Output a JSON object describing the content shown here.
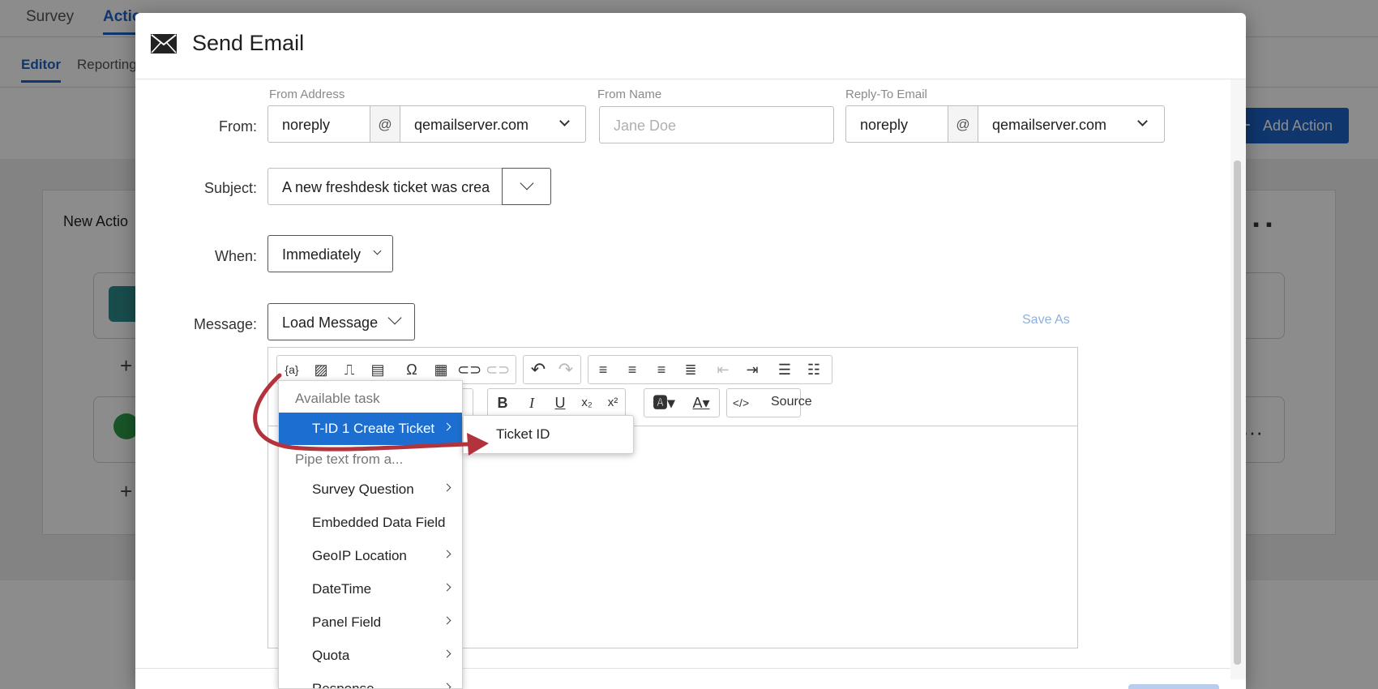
{
  "background": {
    "top_tabs": [
      "Survey",
      "Actio"
    ],
    "sub_tabs": [
      "Editor",
      "Reporting"
    ],
    "card_title": "New Actio",
    "add_action_label": "Add Action"
  },
  "modal": {
    "title": "Send Email",
    "from": {
      "label": "From:",
      "address_caption": "From Address",
      "address_user": "noreply",
      "at": "@",
      "address_domain": "qemailserver.com",
      "name_caption": "From Name",
      "name_placeholder": "Jane Doe",
      "reply_caption": "Reply-To Email",
      "reply_user": "noreply",
      "reply_domain": "qemailserver.com"
    },
    "subject": {
      "label": "Subject:",
      "value": "A new freshdesk ticket was crea"
    },
    "when": {
      "label": "When:",
      "value": "Immediately"
    },
    "message": {
      "label": "Message:",
      "load_label": "Load Message",
      "save_as": "Save As"
    },
    "toolbar": {
      "source_label": "Source"
    }
  },
  "piped_menu": {
    "available_task_header": "Available task",
    "selected_item": "T-ID 1 Create Ticket",
    "pipe_header": "Pipe text from a...",
    "items": [
      {
        "label": "Survey Question",
        "submenu": true
      },
      {
        "label": "Embedded Data Field",
        "submenu": false
      },
      {
        "label": "GeoIP Location",
        "submenu": true
      },
      {
        "label": "DateTime",
        "submenu": true
      },
      {
        "label": "Panel Field",
        "submenu": true
      },
      {
        "label": "Quota",
        "submenu": true
      },
      {
        "label": "Response",
        "submenu": true
      }
    ],
    "submenu_item": "Ticket ID"
  },
  "colors": {
    "accent": "#1c6fd1",
    "annotation_arrow": "#b3333d"
  }
}
